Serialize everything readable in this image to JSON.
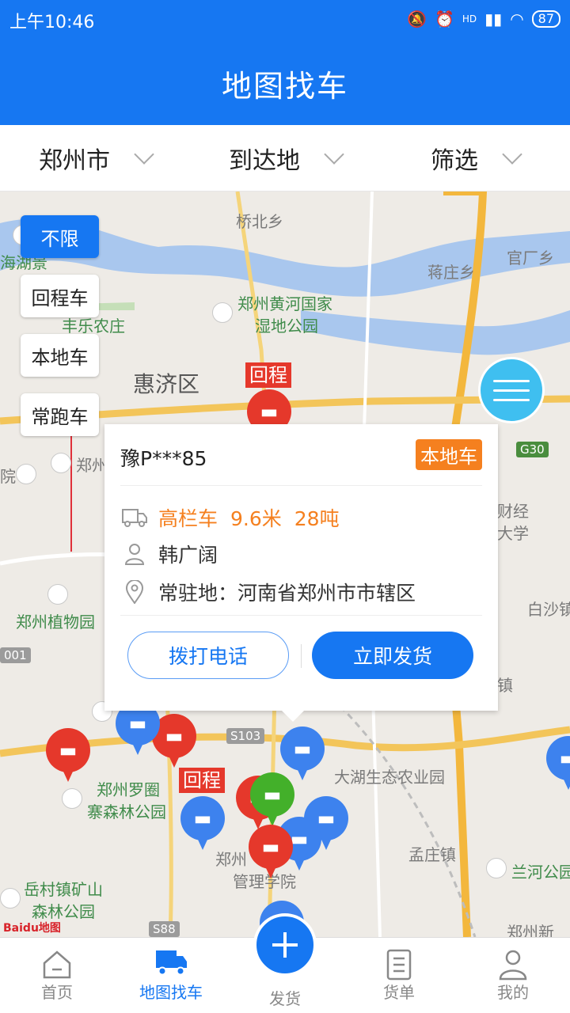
{
  "status_bar": {
    "time": "上午10:46",
    "battery": "87",
    "network": "HD"
  },
  "header": {
    "title": "地图找车"
  },
  "filters": [
    {
      "label": "郑州市"
    },
    {
      "label": "到达地"
    },
    {
      "label": "筛选"
    }
  ],
  "chips": [
    "不限",
    "回程车",
    "本地车",
    "常跑车"
  ],
  "map": {
    "places": {
      "qiaobei": "桥北乡",
      "jiangzhuang": "蒋庄乡",
      "guanchang": "官厂乡",
      "wetland_1": "郑州黄河国家",
      "wetland_2": "湿地公园",
      "fengle": "丰乐农庄",
      "huiji": "惠济区",
      "haihu": "海湖景",
      "zhengzhou_short": "郑州",
      "caijing_1": "财经",
      "caijing_2": "大学",
      "botanical": "郑州植物园",
      "baisha": "白沙镇",
      "zhen": "镇",
      "dahu": "大湖生态农业园",
      "luoquan_1": "郑州罗圈",
      "luoquan_2": "寨森林公园",
      "mengzhuang": "孟庄镇",
      "lanhe": "兰河公园",
      "yuecun_1": "岳村镇矿山",
      "yuecun_2": "森林公园",
      "mgmt_1": "郑州",
      "mgmt_2": "管理学院",
      "newdist": "郑州新",
      "college": "院",
      "baidu_map": "Baidu地图"
    },
    "road_tags": {
      "g30": "G30",
      "s103": "S103",
      "s88": "S88",
      "r001": "001"
    },
    "return_tag": "回程"
  },
  "popup": {
    "plate": "豫P***85",
    "badge": "本地车",
    "truck_type": "高栏车",
    "truck_length": "9.6米",
    "truck_load": "28吨",
    "driver": "韩广阔",
    "base_label": "常驻地：",
    "base_value": "河南省郑州市市辖区",
    "call_button": "拨打电话",
    "ship_button": "立即发货"
  },
  "bottom_nav": {
    "home": "首页",
    "map_find": "地图找车",
    "ship": "发货",
    "orders": "货单",
    "mine": "我的"
  },
  "colors": {
    "primary": "#1677f2",
    "orange": "#f5801f",
    "red_pin": "#e5382b",
    "blue_pin": "#3d82ee",
    "green_pin": "#43b02a"
  }
}
